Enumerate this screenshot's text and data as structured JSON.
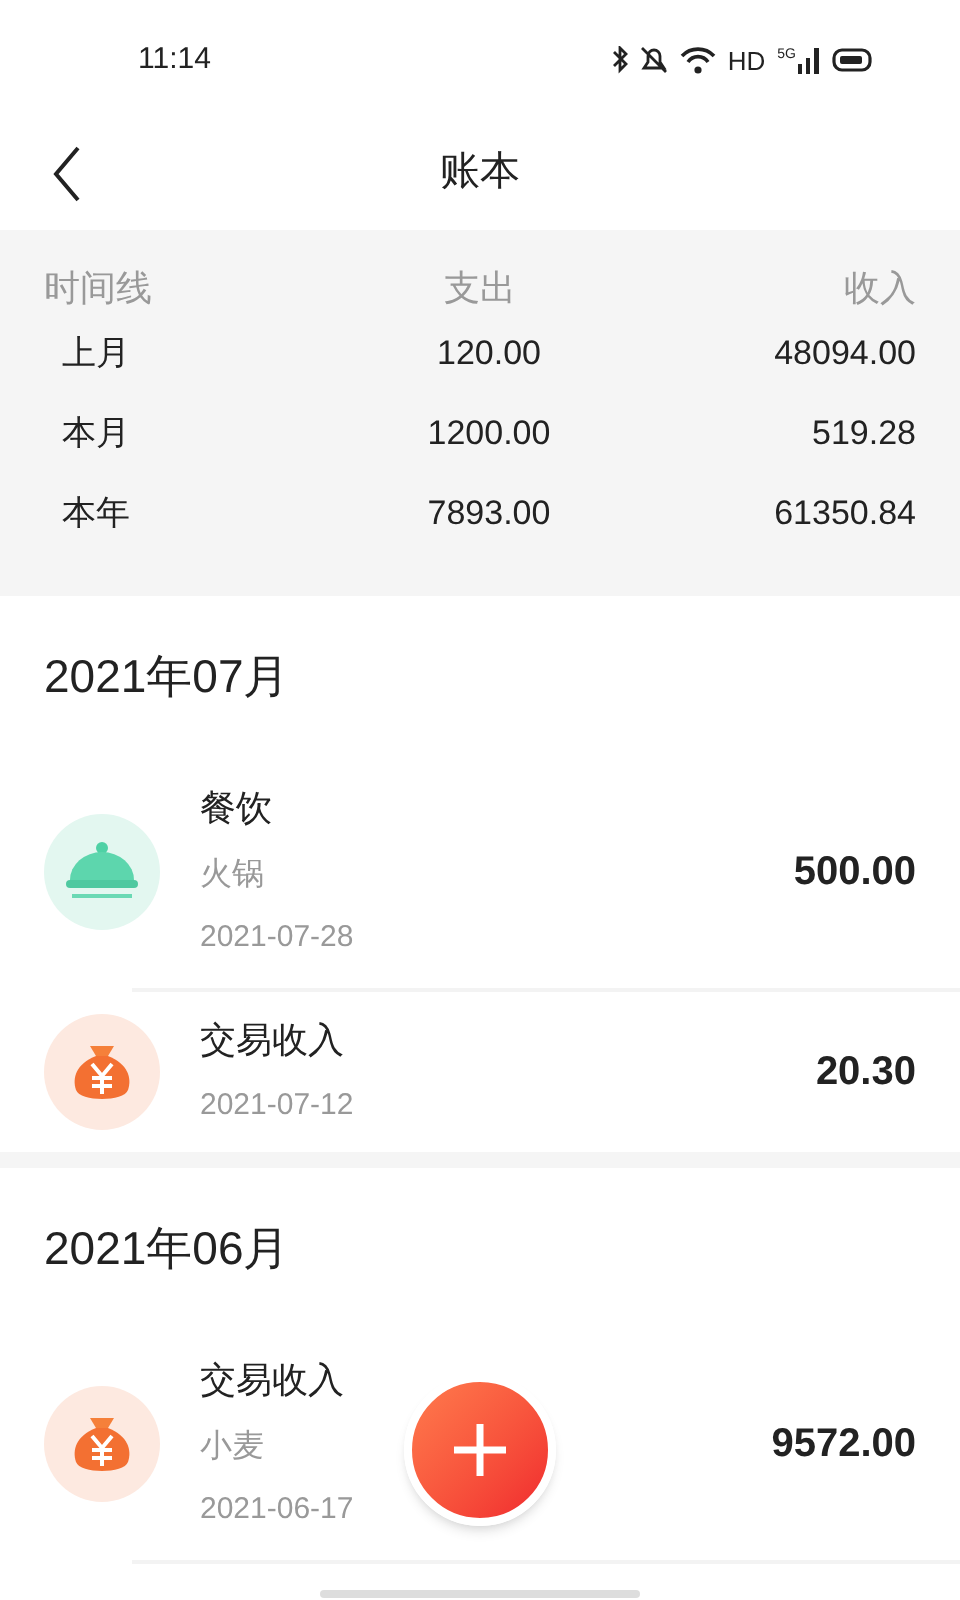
{
  "status_bar": {
    "time": "11:14",
    "hd": "HD",
    "network": "5G"
  },
  "header": {
    "title": "账本"
  },
  "summary": {
    "columns": [
      "时间线",
      "支出",
      "收入"
    ],
    "rows": [
      {
        "period": "上月",
        "expense": "120.00",
        "income": "48094.00"
      },
      {
        "period": "本月",
        "expense": "1200.00",
        "income": "519.28"
      },
      {
        "period": "本年",
        "expense": "7893.00",
        "income": "61350.84"
      }
    ]
  },
  "months": [
    {
      "title": "2021年07月",
      "entries": [
        {
          "kind": "dining",
          "category": "餐饮",
          "note": "火锅",
          "date": "2021-07-28",
          "amount": "500.00"
        },
        {
          "kind": "income",
          "category": "交易收入",
          "date": "2021-07-12",
          "amount": "20.30"
        }
      ]
    },
    {
      "title": "2021年06月",
      "entries": [
        {
          "kind": "income",
          "category": "交易收入",
          "note": "小麦",
          "date": "2021-06-17",
          "amount": "9572.00"
        }
      ]
    }
  ]
}
